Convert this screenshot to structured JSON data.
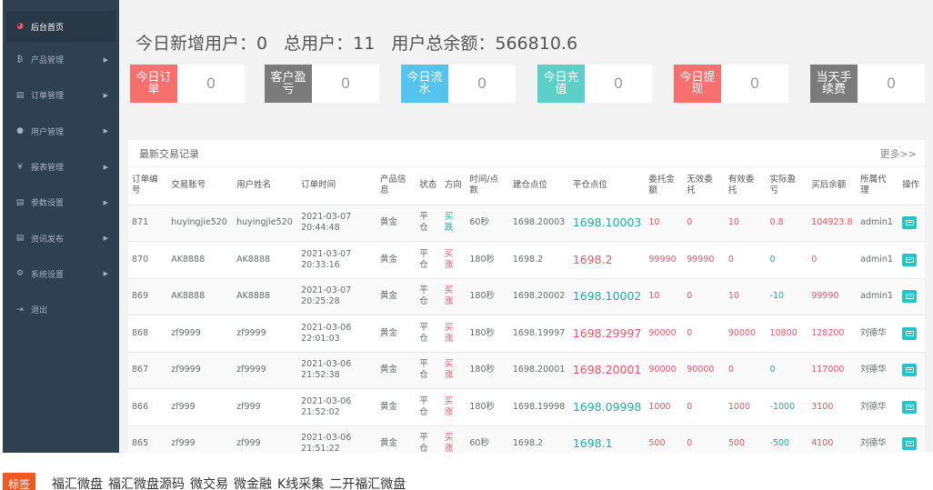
{
  "sidebar": {
    "items": [
      {
        "label": "后台首页",
        "icon": "dashboard-icon",
        "glyph": "◕",
        "active": true
      },
      {
        "label": "产品管理",
        "icon": "bitcoin-icon",
        "glyph": "₿"
      },
      {
        "label": "订单管理",
        "icon": "documents-icon",
        "glyph": "▤"
      },
      {
        "label": "用户管理",
        "icon": "user-icon",
        "glyph": "●"
      },
      {
        "label": "报表管理",
        "icon": "yen-icon",
        "glyph": "¥"
      },
      {
        "label": "参数设置",
        "icon": "documents-icon",
        "glyph": "▤"
      },
      {
        "label": "资讯发布",
        "icon": "documents-icon",
        "glyph": "▤"
      },
      {
        "label": "系统设置",
        "icon": "gears-icon",
        "glyph": "⚙"
      },
      {
        "label": "退出",
        "icon": "sign-out-icon",
        "glyph": "⇥"
      }
    ]
  },
  "headline": {
    "new_users": "今日新增用户：0",
    "total_users": "总用户：11",
    "total_balance": "用户总余额：566810.6"
  },
  "stats": [
    {
      "label": "今日订单",
      "value": "0",
      "color": "#f8706d"
    },
    {
      "label": "客户盈亏",
      "value": "0",
      "color": "#7b7b7b"
    },
    {
      "label": "今日流水",
      "value": "0",
      "color": "#54c3ee"
    },
    {
      "label": "今日充值",
      "value": "0",
      "color": "#5ccfc8"
    },
    {
      "label": "今日提现",
      "value": "0",
      "color": "#f8706d"
    },
    {
      "label": "当天手续费",
      "value": "0",
      "color": "#7b7b7b"
    }
  ],
  "panel": {
    "title": "最新交易记录",
    "more": "更多>>"
  },
  "table": {
    "headers": [
      "订单编号",
      "交易账号",
      "用户姓名",
      "订单时间",
      "产品信息",
      "状态",
      "方向",
      "时间/点数",
      "建仓点位",
      "平仓点位",
      "委托金额",
      "无效委托",
      "有效委托",
      "实际盈亏",
      "买后余额",
      "所属代理",
      "操作"
    ],
    "rows": [
      {
        "id": "871",
        "account": "huyingjie520",
        "name": "huyingjie520",
        "date": "2021-03-07",
        "time": "20:44:48",
        "product": "黄金",
        "status": "平仓",
        "direction": "买跌",
        "dir_color": "green",
        "duration": "60秒",
        "open": "1698.20003",
        "close": "1698.10003",
        "close_color": "green",
        "entrust": "10",
        "invalid": "0",
        "valid": "10",
        "profit": "0.8",
        "balance": "104923.8",
        "agent": "admin1"
      },
      {
        "id": "870",
        "account": "AK8888",
        "name": "AK8888",
        "date": "2021-03-07",
        "time": "20:33:16",
        "product": "黄金",
        "status": "平仓",
        "direction": "买涨",
        "dir_color": "red",
        "duration": "180秒",
        "open": "1698.2",
        "close": "1698.2",
        "close_color": "red",
        "entrust": "99990",
        "invalid": "99990",
        "valid": "0",
        "profit": "0",
        "balance": "0",
        "agent": "admin1"
      },
      {
        "id": "869",
        "account": "AK8888",
        "name": "AK8888",
        "date": "2021-03-07",
        "time": "20:25:28",
        "product": "黄金",
        "status": "平仓",
        "direction": "买涨",
        "dir_color": "red",
        "duration": "180秒",
        "open": "1698.20002",
        "close": "1698.10002",
        "close_color": "green",
        "entrust": "10",
        "invalid": "0",
        "valid": "10",
        "profit": "-10",
        "balance": "99990",
        "agent": "admin1"
      },
      {
        "id": "868",
        "account": "zf9999",
        "name": "zf9999",
        "date": "2021-03-06",
        "time": "22:01:03",
        "product": "黄金",
        "status": "平仓",
        "direction": "买涨",
        "dir_color": "red",
        "duration": "180秒",
        "open": "1698.19997",
        "close": "1698.29997",
        "close_color": "red",
        "entrust": "90000",
        "invalid": "0",
        "valid": "90000",
        "profit": "10800",
        "balance": "128200",
        "agent": "刘德华"
      },
      {
        "id": "867",
        "account": "zf9999",
        "name": "zf9999",
        "date": "2021-03-06",
        "time": "21:52:38",
        "product": "黄金",
        "status": "平仓",
        "direction": "买涨",
        "dir_color": "red",
        "duration": "180秒",
        "open": "1698.20001",
        "close": "1698.20001",
        "close_color": "red",
        "entrust": "90000",
        "invalid": "90000",
        "valid": "0",
        "profit": "0",
        "balance": "117000",
        "agent": "刘德华"
      },
      {
        "id": "866",
        "account": "zf999",
        "name": "zf999",
        "date": "2021-03-06",
        "time": "21:52:02",
        "product": "黄金",
        "status": "平仓",
        "direction": "买涨",
        "dir_color": "red",
        "duration": "180秒",
        "open": "1698.19998",
        "close": "1698.09998",
        "close_color": "green",
        "entrust": "1000",
        "invalid": "0",
        "valid": "1000",
        "profit": "-1000",
        "balance": "3100",
        "agent": "刘德华"
      },
      {
        "id": "865",
        "account": "zf999",
        "name": "zf999",
        "date": "2021-03-06",
        "time": "21:51:22",
        "product": "黄金",
        "status": "平仓",
        "direction": "买涨",
        "dir_color": "red",
        "duration": "60秒",
        "open": "1698.2",
        "close": "1698.1",
        "close_color": "green",
        "entrust": "500",
        "invalid": "0",
        "valid": "500",
        "profit": "-500",
        "balance": "4100",
        "agent": "刘德华"
      }
    ]
  },
  "footer": {
    "label": "标签",
    "tags": [
      "福汇微盘",
      "福汇微盘源码",
      "微交易",
      "微金融",
      "K线采集",
      "二开福汇微盘"
    ]
  }
}
